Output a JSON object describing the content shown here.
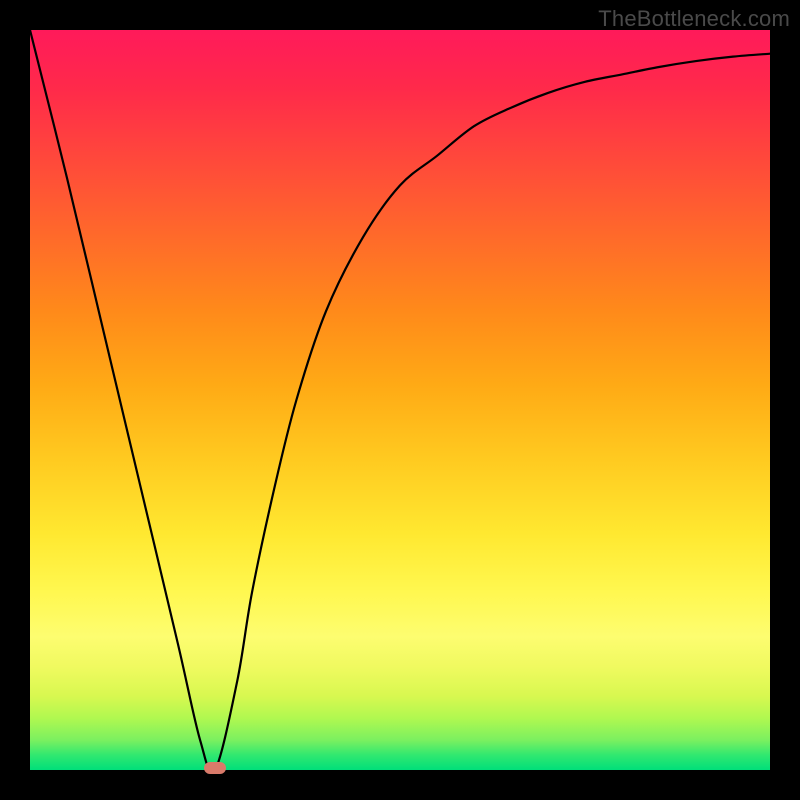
{
  "watermark": "TheBottleneck.com",
  "chart_data": {
    "type": "line",
    "title": "",
    "xlabel": "",
    "ylabel": "",
    "xlim": [
      0,
      100
    ],
    "ylim": [
      0,
      100
    ],
    "grid": false,
    "legend": false,
    "background_gradient": {
      "orientation": "vertical",
      "stops": [
        {
          "pos": 0,
          "color": "#ff1a5a"
        },
        {
          "pos": 50,
          "color": "#ffca20"
        },
        {
          "pos": 80,
          "color": "#fdfd70"
        },
        {
          "pos": 100,
          "color": "#00df7a"
        }
      ]
    },
    "series": [
      {
        "name": "bottleneck-curve",
        "color": "#000000",
        "x": [
          0,
          5,
          10,
          15,
          20,
          23,
          25,
          28,
          30,
          33,
          36,
          40,
          45,
          50,
          55,
          60,
          65,
          70,
          75,
          80,
          85,
          90,
          95,
          100
        ],
        "y": [
          100,
          80,
          59,
          38,
          17,
          4,
          0,
          12,
          24,
          38,
          50,
          62,
          72,
          79,
          83,
          87,
          89.5,
          91.5,
          93,
          94,
          95,
          95.8,
          96.4,
          96.8
        ]
      }
    ],
    "markers": [
      {
        "name": "optimal-point",
        "x": 25,
        "y": 0,
        "color": "#d97a6a",
        "shape": "pill"
      }
    ]
  }
}
